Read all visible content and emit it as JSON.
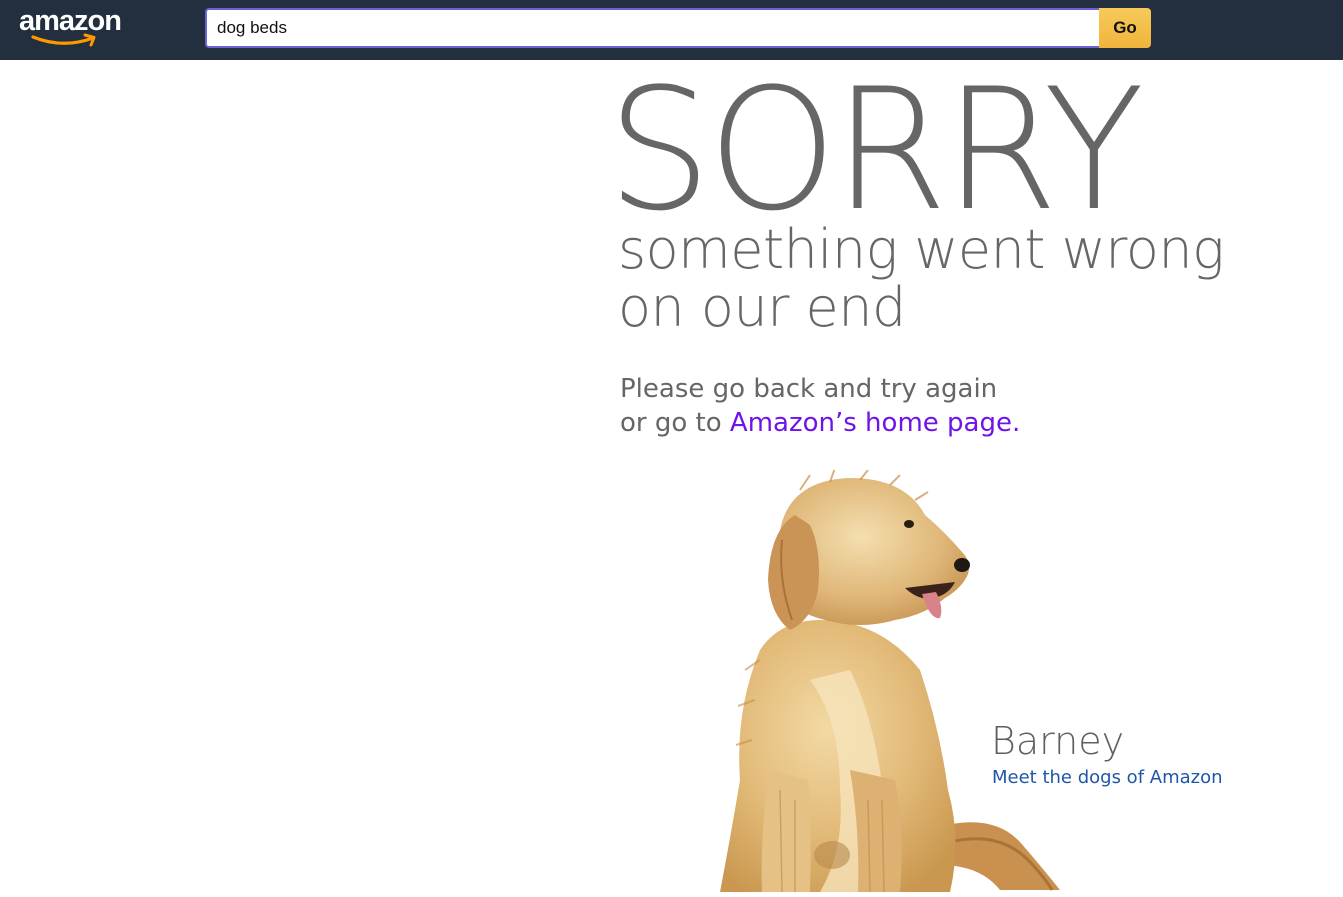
{
  "header": {
    "logo_text": "amazon",
    "search": {
      "value": "dog beds",
      "placeholder": ""
    },
    "go_label": "Go"
  },
  "error": {
    "title": "SORRY",
    "subtitle_line1": "something went wrong",
    "subtitle_line2": "on our end",
    "instruction_line1": "Please go back and try again",
    "instruction_prefix": "or go to ",
    "home_link_label": "Amazon’s home page."
  },
  "dog": {
    "name": "Barney",
    "link_label": "Meet the dogs of Amazon"
  },
  "colors": {
    "topbar": "#232f3e",
    "go_button": "#f0b43c",
    "search_border": "#6b62d6",
    "text_gray": "#666666",
    "home_link": "#6f13e8",
    "dogs_link": "#1f56a8",
    "logo_arrow": "#ff9900"
  }
}
